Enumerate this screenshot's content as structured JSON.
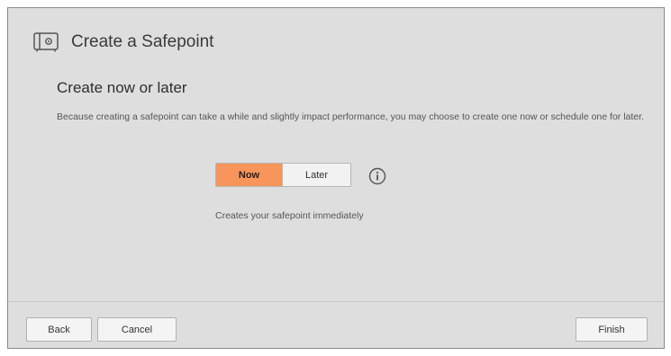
{
  "dialog": {
    "title": "Create a Safepoint",
    "icon": "safe-icon"
  },
  "step": {
    "heading": "Create now or later",
    "description": "Because creating a safepoint can take a while and slightly impact performance, you may choose to create one now or schedule one for later."
  },
  "toggle": {
    "options": [
      "Now",
      "Later"
    ],
    "selected": "Now",
    "selected_color": "#f7955a",
    "info_icon": "info-icon"
  },
  "helper_text": "Creates your safepoint immediately",
  "footer": {
    "back_label": "Back",
    "cancel_label": "Cancel",
    "finish_label": "Finish"
  }
}
